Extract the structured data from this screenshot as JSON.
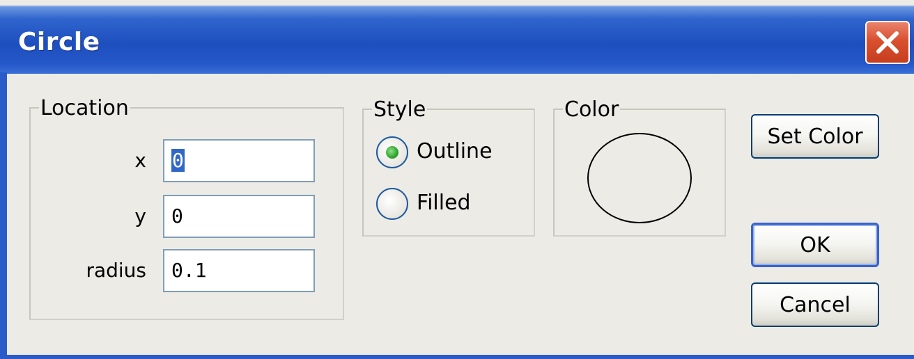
{
  "window": {
    "title": "Circle"
  },
  "location": {
    "legend": "Location",
    "x_label": "x",
    "x_value": "0",
    "y_label": "y",
    "y_value": "0",
    "radius_label": "radius",
    "radius_value": "0.1"
  },
  "style": {
    "legend": "Style",
    "options": [
      {
        "label": "Outline",
        "selected": true
      },
      {
        "label": "Filled",
        "selected": false
      }
    ]
  },
  "color": {
    "legend": "Color"
  },
  "buttons": {
    "set_color": "Set Color",
    "ok": "OK",
    "cancel": "Cancel"
  },
  "icons": {
    "close": "close-icon",
    "radio_selected": "radio-selected-icon",
    "radio_unselected": "radio-unselected-icon",
    "preview": "circle-preview-icon"
  },
  "colors": {
    "titlebar": "#1e4fbf",
    "close": "#d9502f",
    "selection": "#3168c8"
  }
}
